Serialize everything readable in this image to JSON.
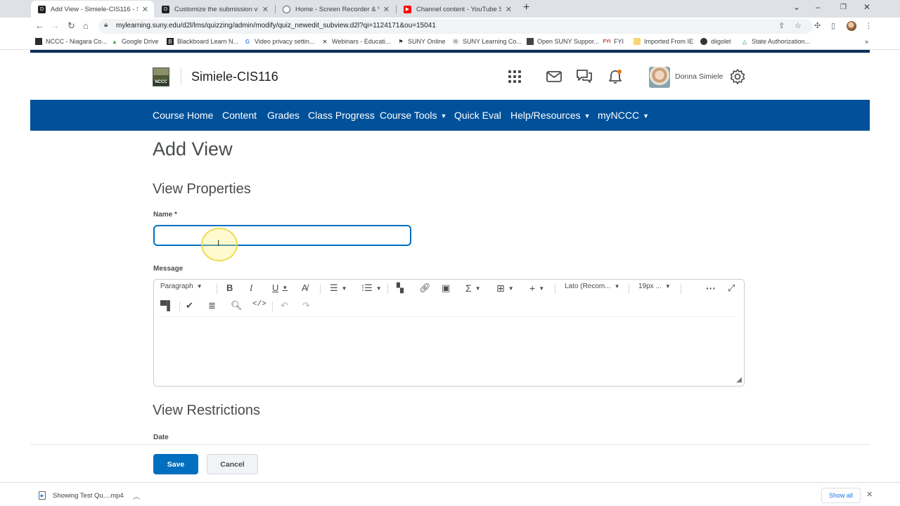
{
  "browser": {
    "tabs": [
      {
        "title": "Add View - Simiele-CIS116 - SUN",
        "icon": "d2l-favicon",
        "active": true
      },
      {
        "title": "Customize the submission view t",
        "icon": "d2l-favicon",
        "active": false
      },
      {
        "title": "Home - Screen Recorder & Video",
        "icon": "screencastify-favicon",
        "active": false
      },
      {
        "title": "Channel content - YouTube Studi",
        "icon": "youtube-favicon",
        "active": false
      }
    ],
    "url": "mylearning.suny.edu/d2l/lms/quizzing/admin/modify/quiz_newedit_subview.d2l?qi=1124171&ou=15041",
    "bookmarks": [
      {
        "label": "NCCC - Niagara Co...",
        "icon": "nccc-icon"
      },
      {
        "label": "Google Drive",
        "icon": "google-drive-icon"
      },
      {
        "label": "Blackboard Learn N...",
        "icon": "blackboard-icon"
      },
      {
        "label": "Video privacy settin...",
        "icon": "google-icon"
      },
      {
        "label": "Webinars - Educati...",
        "icon": "webinar-icon"
      },
      {
        "label": "SUNY Online",
        "icon": "suny-icon"
      },
      {
        "label": "SUNY Learning Co...",
        "icon": "wordpress-icon"
      },
      {
        "label": "Open SUNY Suppor...",
        "icon": "open-suny-icon"
      },
      {
        "label": "FYI",
        "icon": "fyi-icon"
      },
      {
        "label": "Imported From IE",
        "icon": "folder-icon"
      },
      {
        "label": "diigolet",
        "icon": "diigo-icon"
      },
      {
        "label": "State Authorization...",
        "icon": "drive-icon"
      }
    ],
    "download": {
      "filename": "Showing Test Qu....mp4",
      "show_all": "Show all"
    }
  },
  "header": {
    "logo_text": "NCCC",
    "course_title": "Simiele-CIS116",
    "user_name": "Donna Simiele"
  },
  "navbar": {
    "items": [
      {
        "label": "Course Home",
        "dropdown": false
      },
      {
        "label": "Content",
        "dropdown": false
      },
      {
        "label": "Grades",
        "dropdown": false
      },
      {
        "label": "Class Progress",
        "dropdown": false
      },
      {
        "label": "Course Tools",
        "dropdown": true
      },
      {
        "label": "Quick Eval",
        "dropdown": false
      },
      {
        "label": "Help/Resources",
        "dropdown": true
      },
      {
        "label": "myNCCC",
        "dropdown": true
      }
    ]
  },
  "main": {
    "page_title": "Add View",
    "section_properties": "View Properties",
    "name_label": "Name *",
    "name_value": "",
    "message_label": "Message",
    "editor": {
      "format_block": "Paragraph",
      "font_family": "Lato (Recom...",
      "font_size": "19px ..."
    },
    "section_restrictions": "View Restrictions",
    "date_label": "Date"
  },
  "footer": {
    "save_label": "Save",
    "cancel_label": "Cancel"
  },
  "colors": {
    "navbar": "#01519a",
    "primary_button": "#006fbf",
    "focus_border": "#006fbf"
  }
}
